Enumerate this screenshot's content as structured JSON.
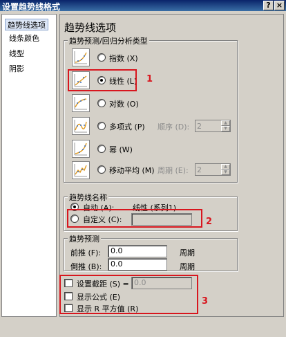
{
  "window": {
    "title": "设置趋势线格式",
    "help_label": "?",
    "close_label": "×"
  },
  "nav": {
    "items": [
      {
        "label": "趋势线选项"
      },
      {
        "label": "线条颜色"
      },
      {
        "label": "线型"
      },
      {
        "label": "阴影"
      }
    ]
  },
  "panel": {
    "title": "趋势线选项",
    "type_group": {
      "legend": "趋势预测/回归分析类型",
      "options": [
        {
          "label": "指数 (X)",
          "selected": false
        },
        {
          "label": "线性 (L)",
          "selected": true
        },
        {
          "label": "对数 (O)",
          "selected": false
        },
        {
          "label": "多项式 (P)",
          "selected": false
        },
        {
          "label": "幂 (W)",
          "selected": false
        },
        {
          "label": "移动平均 (M)",
          "selected": false
        }
      ],
      "order_label": "顺序 (D):",
      "order_value": "2",
      "period_label": "周期 (E):",
      "period_value": "2"
    },
    "name_group": {
      "legend": "趋势线名称",
      "auto_label": "自动 (A):",
      "auto_value": "线性 (系列1)",
      "custom_label": "自定义 (C):",
      "custom_value": ""
    },
    "forecast_group": {
      "legend": "趋势预测",
      "forward_label": "前推 (F):",
      "forward_value": "0.0",
      "forward_unit": "周期",
      "backward_label": "倒推 (B):",
      "backward_value": "0.0",
      "backward_unit": "周期"
    },
    "options": {
      "intercept_label": "设置截距 (S) =",
      "intercept_value": "0.0",
      "equation_label": "显示公式 (E)",
      "rsquared_label": "显示 R 平方值 (R)"
    }
  },
  "annotations": [
    "1",
    "2",
    "3"
  ],
  "colors": {
    "annotation": "#d8161e",
    "titlebar": "#0a246a"
  }
}
